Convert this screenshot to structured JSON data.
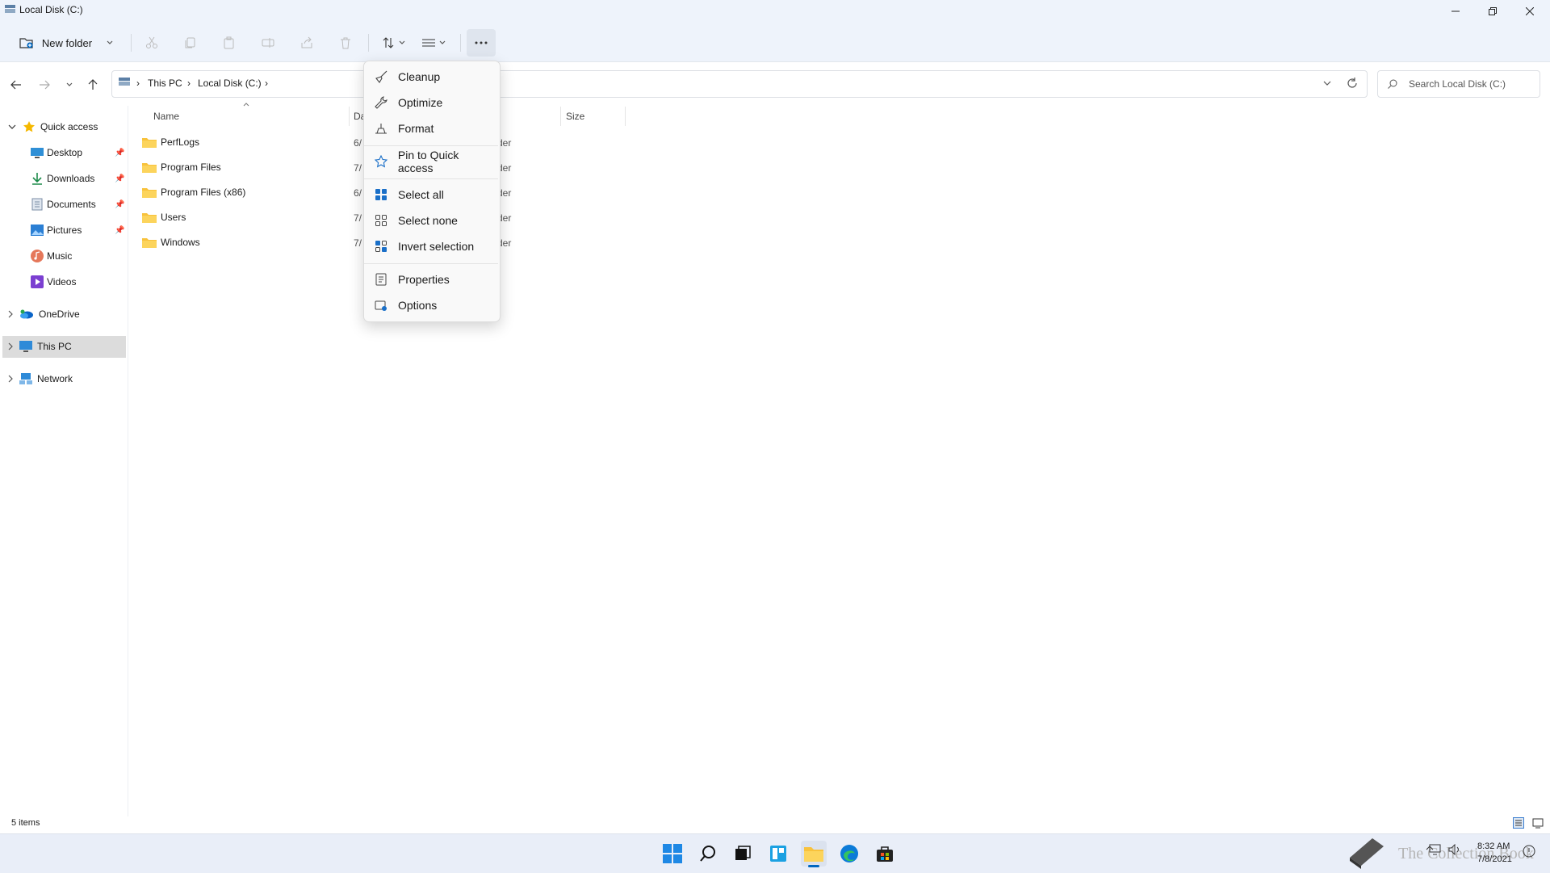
{
  "window": {
    "title": "Local Disk (C:)"
  },
  "toolbar": {
    "new_folder_label": "New folder"
  },
  "address": {
    "crumbs": [
      "This PC",
      "Local Disk (C:)"
    ],
    "search_placeholder": "Search Local Disk (C:)"
  },
  "sidebar": {
    "quick_access": "Quick access",
    "items": [
      {
        "label": "Desktop",
        "icon": "desktop-icon",
        "pinned": true
      },
      {
        "label": "Downloads",
        "icon": "download-icon",
        "pinned": true
      },
      {
        "label": "Documents",
        "icon": "document-icon",
        "pinned": true
      },
      {
        "label": "Pictures",
        "icon": "picture-icon",
        "pinned": true
      },
      {
        "label": "Music",
        "icon": "music-icon",
        "pinned": false
      },
      {
        "label": "Videos",
        "icon": "video-icon",
        "pinned": false
      }
    ],
    "onedrive": "OneDrive",
    "this_pc": "This PC",
    "network": "Network"
  },
  "columns": {
    "name": "Name",
    "date": "Da",
    "size": "Size"
  },
  "files": [
    {
      "name": "PerfLogs",
      "date": "6/",
      "type": "der"
    },
    {
      "name": "Program Files",
      "date": "7/",
      "type": "der"
    },
    {
      "name": "Program Files (x86)",
      "date": "6/",
      "type": "der"
    },
    {
      "name": "Users",
      "date": "7/",
      "type": "der"
    },
    {
      "name": "Windows",
      "date": "7/",
      "type": "der"
    }
  ],
  "menu": {
    "items": [
      {
        "label": "Cleanup",
        "icon": "broom-icon"
      },
      {
        "label": "Optimize",
        "icon": "wrench-icon"
      },
      {
        "label": "Format",
        "icon": "format-icon"
      },
      {
        "label": "Pin to Quick access",
        "icon": "star-icon"
      },
      {
        "label": "Select all",
        "icon": "select-all-icon"
      },
      {
        "label": "Select none",
        "icon": "select-none-icon"
      },
      {
        "label": "Invert selection",
        "icon": "invert-selection-icon"
      },
      {
        "label": "Properties",
        "icon": "properties-icon"
      },
      {
        "label": "Options",
        "icon": "options-icon"
      }
    ]
  },
  "status": {
    "item_count": "5 items"
  },
  "tray": {
    "time": "8:32 AM",
    "date": "7/8/2021"
  },
  "watermark": {
    "text": "The Collection Book"
  },
  "colors": {
    "accent": "#0067c0",
    "folder": "#f8c23c",
    "selected": "#dcdcdc"
  }
}
